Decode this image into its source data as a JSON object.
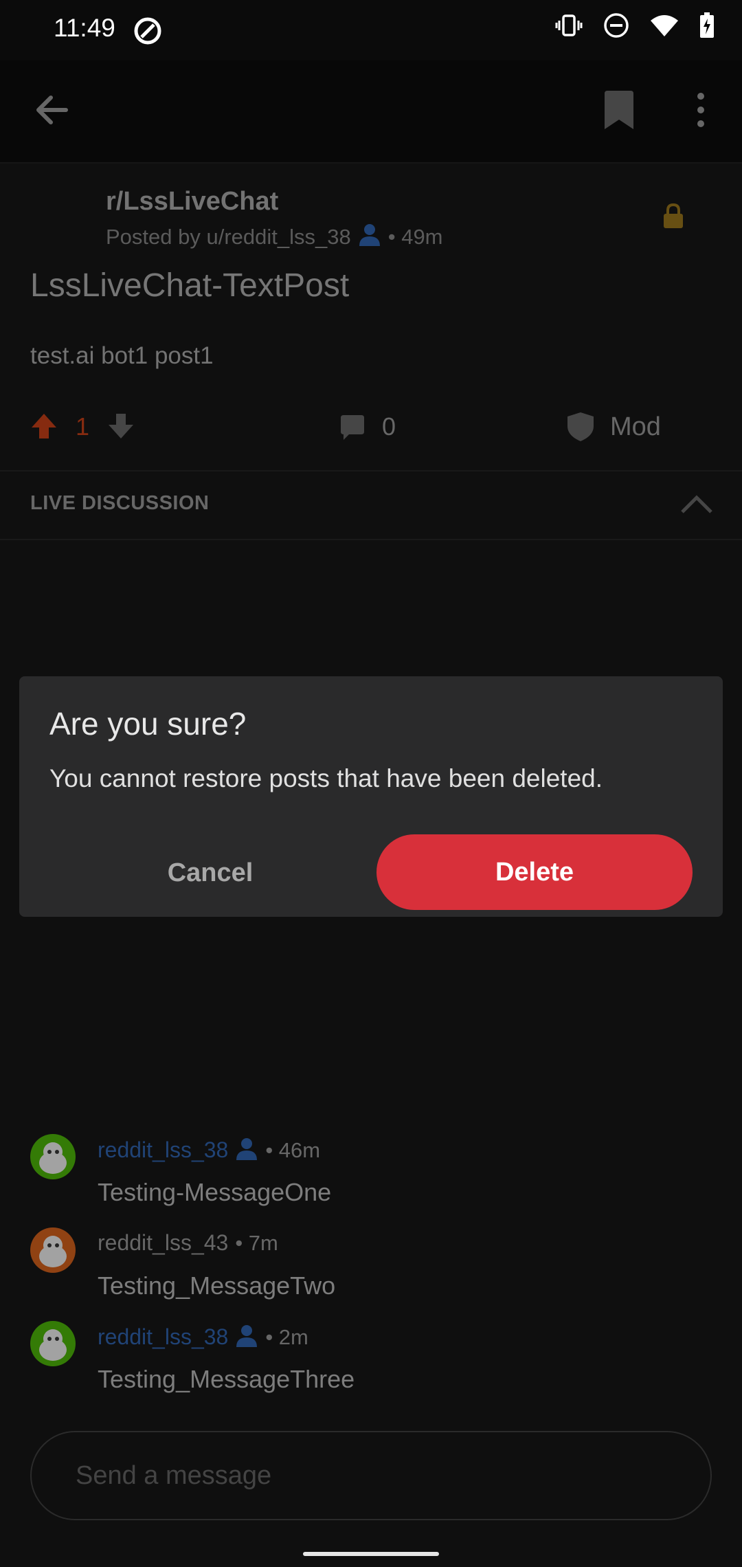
{
  "status_bar": {
    "time": "11:49"
  },
  "post": {
    "subreddit": "r/LssLiveChat",
    "posted_by": "Posted by u/reddit_lss_38",
    "age": "• 49m",
    "title": "LssLiveChat-TextPost",
    "body": "test.ai bot1 post1",
    "vote_count": "1",
    "comment_count": "0",
    "mod_label": "Mod"
  },
  "live_discussion": {
    "title": "LIVE DISCUSSION"
  },
  "dialog": {
    "title": "Are you sure?",
    "message": "You cannot restore posts that have been deleted.",
    "cancel_label": "Cancel",
    "delete_label": "Delete"
  },
  "messages": [
    {
      "user": "reddit_lss_38",
      "meta": "• 46m",
      "text": "Testing-MessageOne"
    },
    {
      "user": "reddit_lss_43",
      "meta": "• 7m",
      "text": "Testing_MessageTwo"
    },
    {
      "user": "reddit_lss_38",
      "meta": "• 2m",
      "text": "Testing_MessageThree"
    }
  ],
  "composer": {
    "placeholder": "Send a message"
  },
  "colors": {
    "delete_button": "#d8303a",
    "upvote": "#b33a16",
    "op_user": "#2b5a9e",
    "lock": "#8a6a1a"
  }
}
